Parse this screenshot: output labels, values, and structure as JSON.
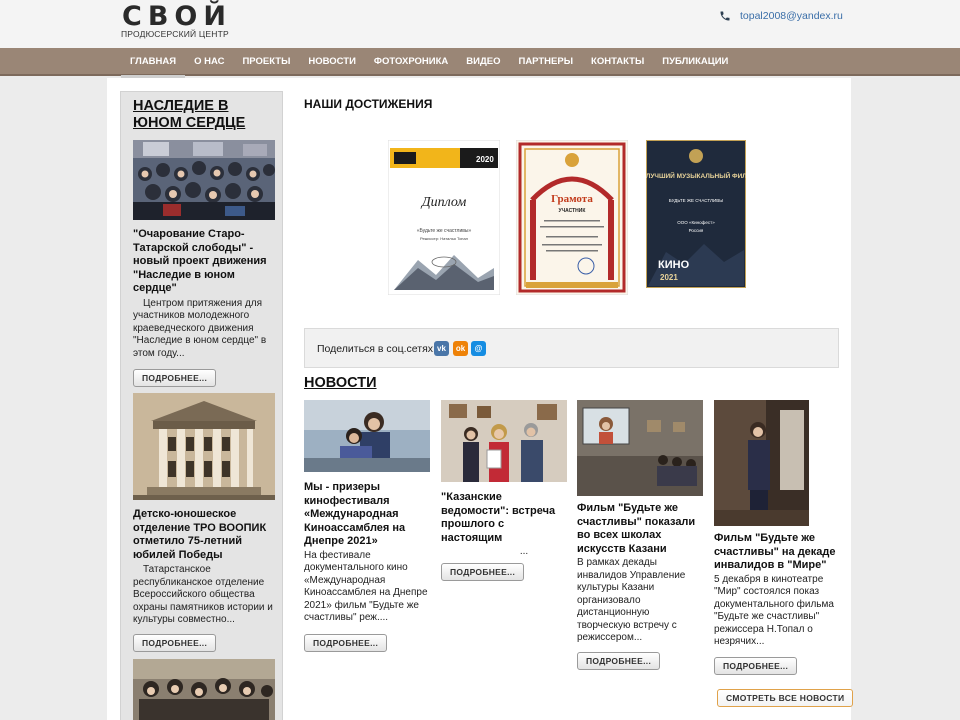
{
  "header": {
    "logo_main": "СВОЙ",
    "logo_sub": "ПРОДЮСЕРСКИЙ ЦЕНТР",
    "email": "topal2008@yandex.ru"
  },
  "nav": {
    "items": [
      "ГЛАВНАЯ",
      "О НАС",
      "ПРОЕКТЫ",
      "НОВОСТИ",
      "ФОТОХРОНИКА",
      "ВИДЕО",
      "ПАРТНЕРЫ",
      "КОНТАКТЫ",
      "ПУБЛИКАЦИИ"
    ]
  },
  "sidebar": {
    "title": "НАСЛЕДИЕ В ЮНОМ СЕРДЦЕ",
    "cards": [
      {
        "title": "\"Очарование Старо-Татарской слободы\" - новый проект движения \"Наследие в юном сердце\"",
        "text": "Центром притяжения для участников молодежного краеведческого движения \"Наследие в юном сердце\" в этом году...",
        "button": "ПОДРОБНЕЕ..."
      },
      {
        "title": "Детско-юношеское отделение ТРО ВООПИК отметило 75-летний юбилей Победы",
        "text": "Татарстанское республиканское отделение Всероссийского общества охраны памятников истории и культуры совместно...",
        "button": "ПОДРОБНЕЕ..."
      }
    ]
  },
  "main": {
    "achievements_title": "НАШИ ДОСТИЖЕНИЯ",
    "diplomas": [
      {
        "year": "2020",
        "heading": "Диплом",
        "film": "«Будьте же счастливы»",
        "director": "Режиссер: Наталья Топал"
      },
      {
        "heading": "Грамота",
        "subheading": "УЧАСТНИК"
      },
      {
        "heading": "ЗА ЛУЧШИЙ МУЗЫКАЛЬНЫЙ ФИЛЬМ",
        "film": "БУДЬТЕ ЖЕ СЧАСТЛИВЫ",
        "company": "ООО «Кинофест»",
        "country": "Россия",
        "brand": "КИНО",
        "year": "2021"
      }
    ],
    "share_label": "Поделиться в соц.сетях:",
    "share_icons": [
      "vk-icon",
      "odnoklassniki-icon",
      "moimir-icon"
    ],
    "news_title": "НОВОСТИ",
    "news": [
      {
        "title": "Мы - призеры кинофестиваля «Международная Киноассамблея на Днепре 2021»",
        "text": "На фестивале документального кино «Международная Киноассамблея на Днепре 2021» фильм \"Будьте же счастливы\" реж....",
        "button": "ПОДРОБНЕЕ..."
      },
      {
        "title": "\"Казанские ведомости\": встреча прошлого с настоящим",
        "text": "...",
        "button": "ПОДРОБНЕЕ..."
      },
      {
        "title": "Фильм \"Будьте же счастливы\" показали во всех школах искусств Казани",
        "text": "В рамках декады инвалидов Управление культуры Казани организовало дистанционную творческую встречу с режиссером...",
        "button": "ПОДРОБНЕЕ..."
      },
      {
        "title": "Фильм \"Будьте же счастливы\" на декаде инвалидов в \"Мире\"",
        "text": "5 декабря в кинотеатре \"Мир\" состоялся показ документального фильма \"Будьте же счастливы\" режиссера Н.Топал о незрячих...",
        "button": "ПОДРОБНЕЕ..."
      }
    ],
    "view_all": "СМОТРЕТЬ ВСЕ НОВОСТИ"
  },
  "colors": {
    "nav_bg": "#9a8676",
    "link": "#3a6ea8",
    "vk": "#4a76a8",
    "ok": "#ee8208",
    "mm": "#168de2",
    "view_all_border": "#e0a24a"
  }
}
